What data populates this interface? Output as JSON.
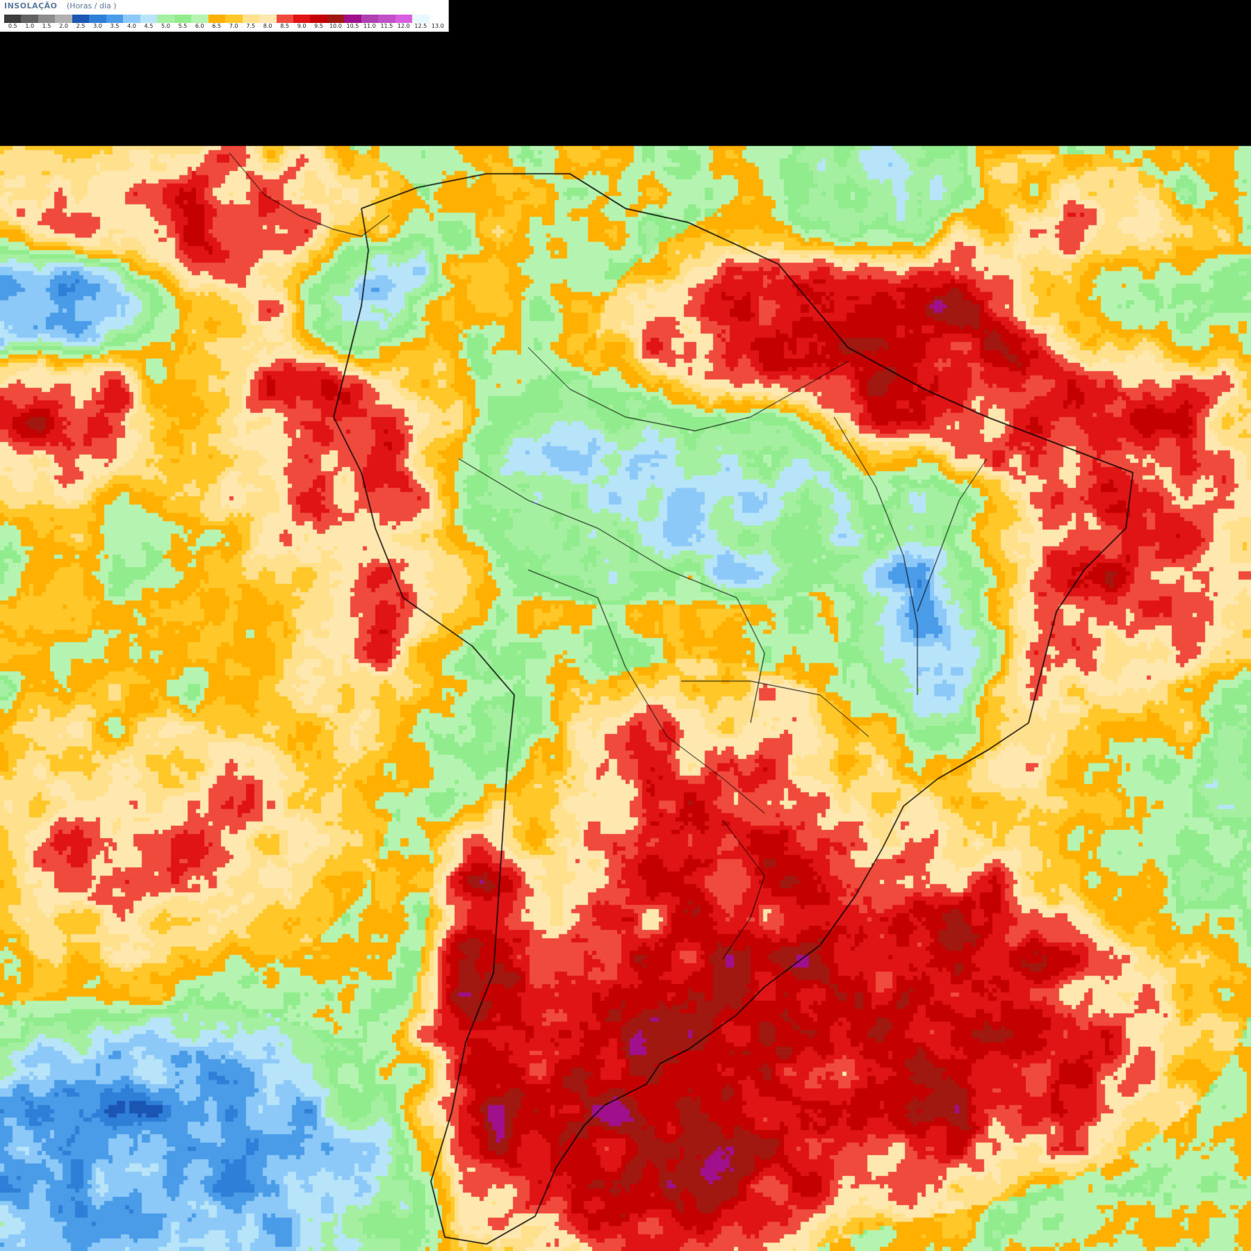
{
  "legend": {
    "title": "INSOLAÇÃO",
    "unit": "(Horas / dia )",
    "colors": [
      "#3c3c3c",
      "#626262",
      "#8c8c8c",
      "#b0b0b0",
      "#1c56b4",
      "#2e7fd8",
      "#4a9ce8",
      "#8cc8f8",
      "#b8e4fa",
      "#a4f0a0",
      "#90ec8c",
      "#b4f4b0",
      "#ffb000",
      "#ffc828",
      "#ffe08c",
      "#ffe8b0",
      "#f04a3c",
      "#e01414",
      "#c40000",
      "#a01810",
      "#a0108c",
      "#b040b0",
      "#c050c8",
      "#d860e0",
      "#e8f8ff",
      "#ffffff"
    ],
    "ticks": [
      "0.5",
      "1.0",
      "1.5",
      "2.0",
      "2.5",
      "3.0",
      "3.5",
      "4.0",
      "4.5",
      "5.0",
      "5.5",
      "6.0",
      "6.5",
      "7.0",
      "7.5",
      "8.0",
      "8.5",
      "9.0",
      "9.5",
      "10.0",
      "10.5",
      "11.0",
      "11.5",
      "12.0",
      "12.5",
      "13.0"
    ]
  }
}
